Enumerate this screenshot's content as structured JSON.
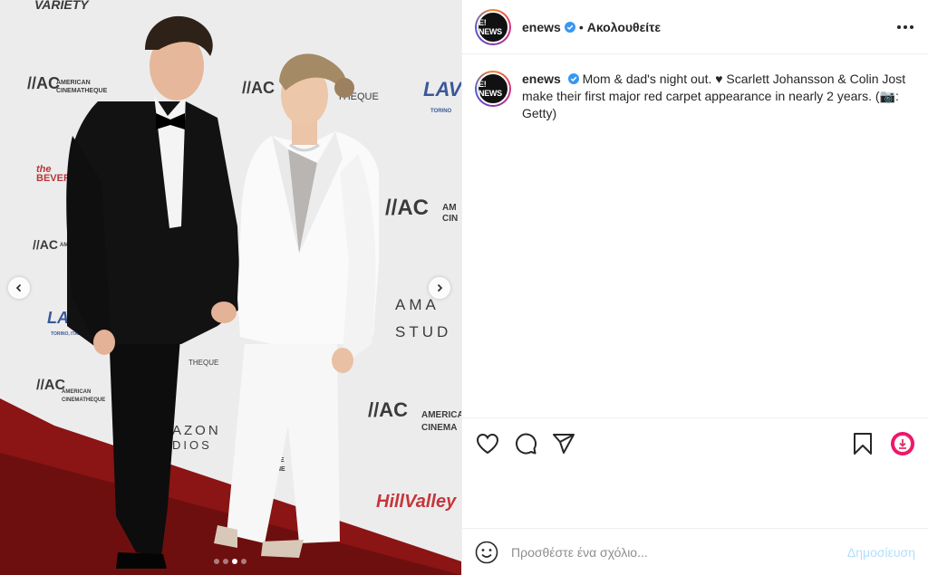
{
  "post": {
    "username": "enews",
    "avatar_label": "E! NEWS",
    "follow_separator": "•",
    "follow_label": "Ακολουθείτε",
    "caption": "Mom & dad's night out. ♥ Scarlett Johansson & Colin Jost make their first major red carpet appearance in nearly 2 years. (📷: Getty)"
  },
  "photo": {
    "backdrop_logos": [
      "VARIETY",
      "AC AMERICAN CINEMATHEQUE",
      "LAVAZZA",
      "AMAZON STUDIOS",
      "the BEVERLY",
      "Hill Valley"
    ],
    "carousel": {
      "total": 4,
      "active_index": 2
    }
  },
  "icons": {
    "verified": "verified-badge-icon",
    "more": "more-options-icon",
    "like": "heart-icon",
    "comment": "comment-bubble-icon",
    "share": "paper-plane-icon",
    "save": "bookmark-icon",
    "extension": "download-extension-icon",
    "emoji": "smiley-icon",
    "prev": "chevron-left-icon",
    "next": "chevron-right-icon"
  },
  "comment": {
    "placeholder": "Προσθέστε ένα σχόλιο...",
    "post_label": "Δημοσίευση"
  },
  "colors": {
    "verified": "#3897f0",
    "post_disabled": "#b2dffc",
    "carpet": "#8b1414"
  }
}
